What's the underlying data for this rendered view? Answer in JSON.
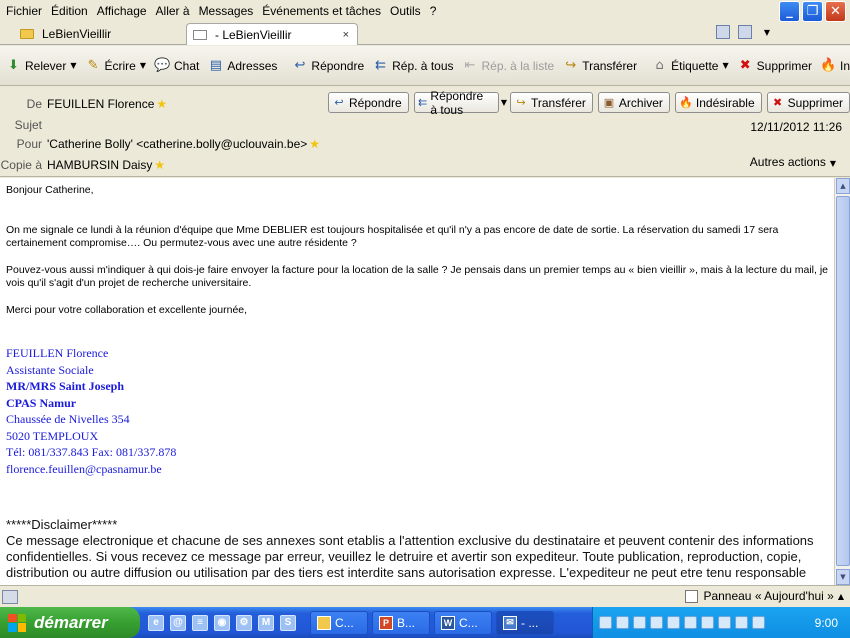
{
  "menu": {
    "items": [
      "Fichier",
      "Édition",
      "Affichage",
      "Aller à",
      "Messages",
      "Événements et tâches",
      "Outils",
      "?"
    ]
  },
  "tabs": [
    {
      "label": "LeBienVieillir"
    },
    {
      "label": "- LeBienVieillir",
      "close": "×"
    }
  ],
  "toolbar": {
    "relever": "Relever",
    "ecrire": "Écrire",
    "chat": "Chat",
    "adresses": "Adresses",
    "repondre": "Répondre",
    "rep_tous": "Rép. à tous",
    "rep_liste": "Rép. à la liste",
    "transferer": "Transférer",
    "etiquette": "Étiquette",
    "supprimer": "Supprimer",
    "indesirable": "Indésirab"
  },
  "header": {
    "de_label": "De",
    "de_value": "FEUILLEN Florence",
    "sujet_label": "Sujet",
    "pour_label": "Pour",
    "pour_value": "'Catherine Bolly' <catherine.bolly@uclouvain.be>",
    "copie_label": "Copie à",
    "copie_value": "HAMBURSIN Daisy",
    "date": "12/11/2012 11:26",
    "more_actions": "Autres actions",
    "buttons": {
      "repondre": "Répondre",
      "repondre_tous": "Répondre à tous",
      "transferer": "Transférer",
      "archiver": "Archiver",
      "indesirable": "Indésirable",
      "supprimer": "Supprimer"
    }
  },
  "message": {
    "greeting": "Bonjour Catherine,",
    "p1": "On me signale ce lundi à la réunion d'équipe que Mme DEBLIER est toujours hospitalisée et qu'il n'y a pas encore de date de sortie.  La réservation du samedi 17 sera certainement compromise…. Ou permutez-vous avec une autre résidente ?",
    "p2": "Pouvez-vous aussi m'indiquer à qui dois-je faire envoyer la facture pour la location de la salle ? Je pensais dans un premier temps au « bien vieillir », mais à la lecture du mail, je vois qu'il s'agit d'un projet de recherche universitaire.",
    "p3": "Merci pour votre collaboration et excellente journée,",
    "signature": {
      "name": "FEUILLEN Florence",
      "role": "Assistante Sociale",
      "org1": "MR/MRS Saint Joseph",
      "org2": "CPAS Namur",
      "street": "Chaussée de Nivelles 354",
      "city": "5020 TEMPLOUX",
      "phone": "Tél: 081/337.843  Fax: 081/337.878",
      "email": "florence.feuillen@cpasnamur.be"
    },
    "disclaimer_title": "*****Disclaimer*****",
    "disclaimer_text": "Ce message electronique et chacune de ses annexes sont etablis a l'attention exclusive du destinataire et peuvent contenir des informations confidentielles. Si vous recevez ce message par erreur, veuillez le detruire et avertir son expediteur. Toute publication, reproduction, copie, distribution ou autre diffusion ou utilisation par des tiers est interdite sans autorisation expresse. L'expediteur ne peut etre tenu responsable"
  },
  "status": {
    "panel": "Panneau « Aujourd'hui »"
  },
  "taskbar": {
    "start": "démarrer",
    "tasks": [
      "C...",
      "B...",
      "C...",
      "- ..."
    ],
    "clock": "9:00"
  }
}
